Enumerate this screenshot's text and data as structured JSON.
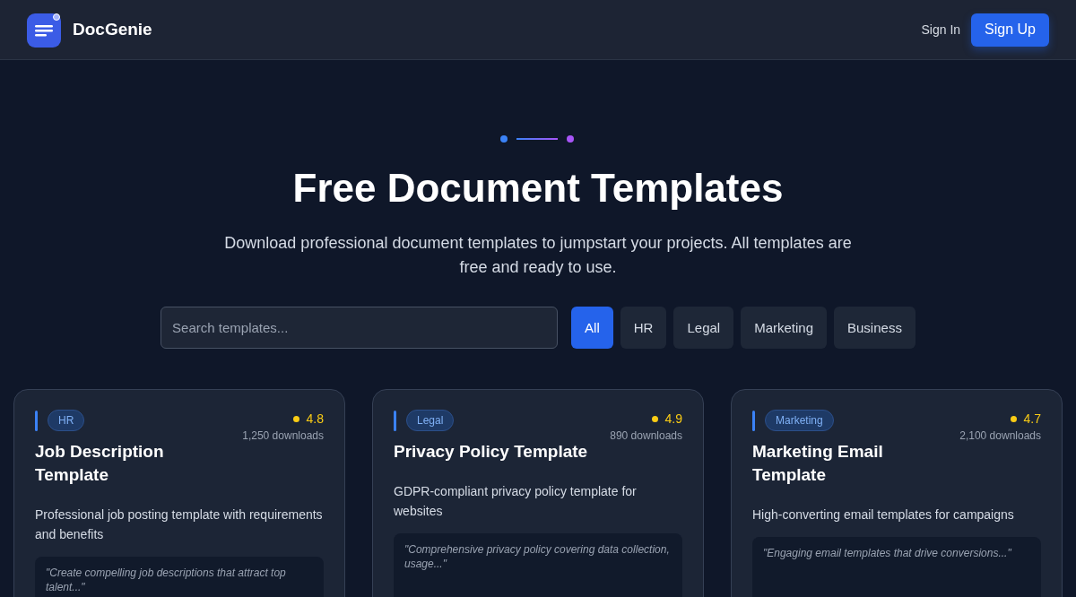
{
  "header": {
    "brand": "DocGenie",
    "sign_in": "Sign In",
    "sign_up": "Sign Up"
  },
  "hero": {
    "title": "Free Document Templates",
    "subtitle": "Download professional document templates to jumpstart your projects. All templates are free and ready to use."
  },
  "search": {
    "placeholder": "Search templates..."
  },
  "filters": [
    {
      "label": "All",
      "selected": true
    },
    {
      "label": "HR",
      "selected": false
    },
    {
      "label": "Legal",
      "selected": false
    },
    {
      "label": "Marketing",
      "selected": false
    },
    {
      "label": "Business",
      "selected": false
    }
  ],
  "templates": [
    {
      "category": "HR",
      "rating": "4.8",
      "downloads": "1,250 downloads",
      "title": "Job Description Template",
      "description": "Professional job posting template with requirements and benefits",
      "preview": "\"Create compelling job descriptions that attract top talent...\""
    },
    {
      "category": "Legal",
      "rating": "4.9",
      "downloads": "890 downloads",
      "title": "Privacy Policy Template",
      "description": "GDPR-compliant privacy policy template for websites",
      "preview": "\"Comprehensive privacy policy covering data collection, usage...\""
    },
    {
      "category": "Marketing",
      "rating": "4.7",
      "downloads": "2,100 downloads",
      "title": "Marketing Email Template",
      "description": "High-converting email templates for campaigns",
      "preview": "\"Engaging email templates that drive conversions...\""
    }
  ]
}
